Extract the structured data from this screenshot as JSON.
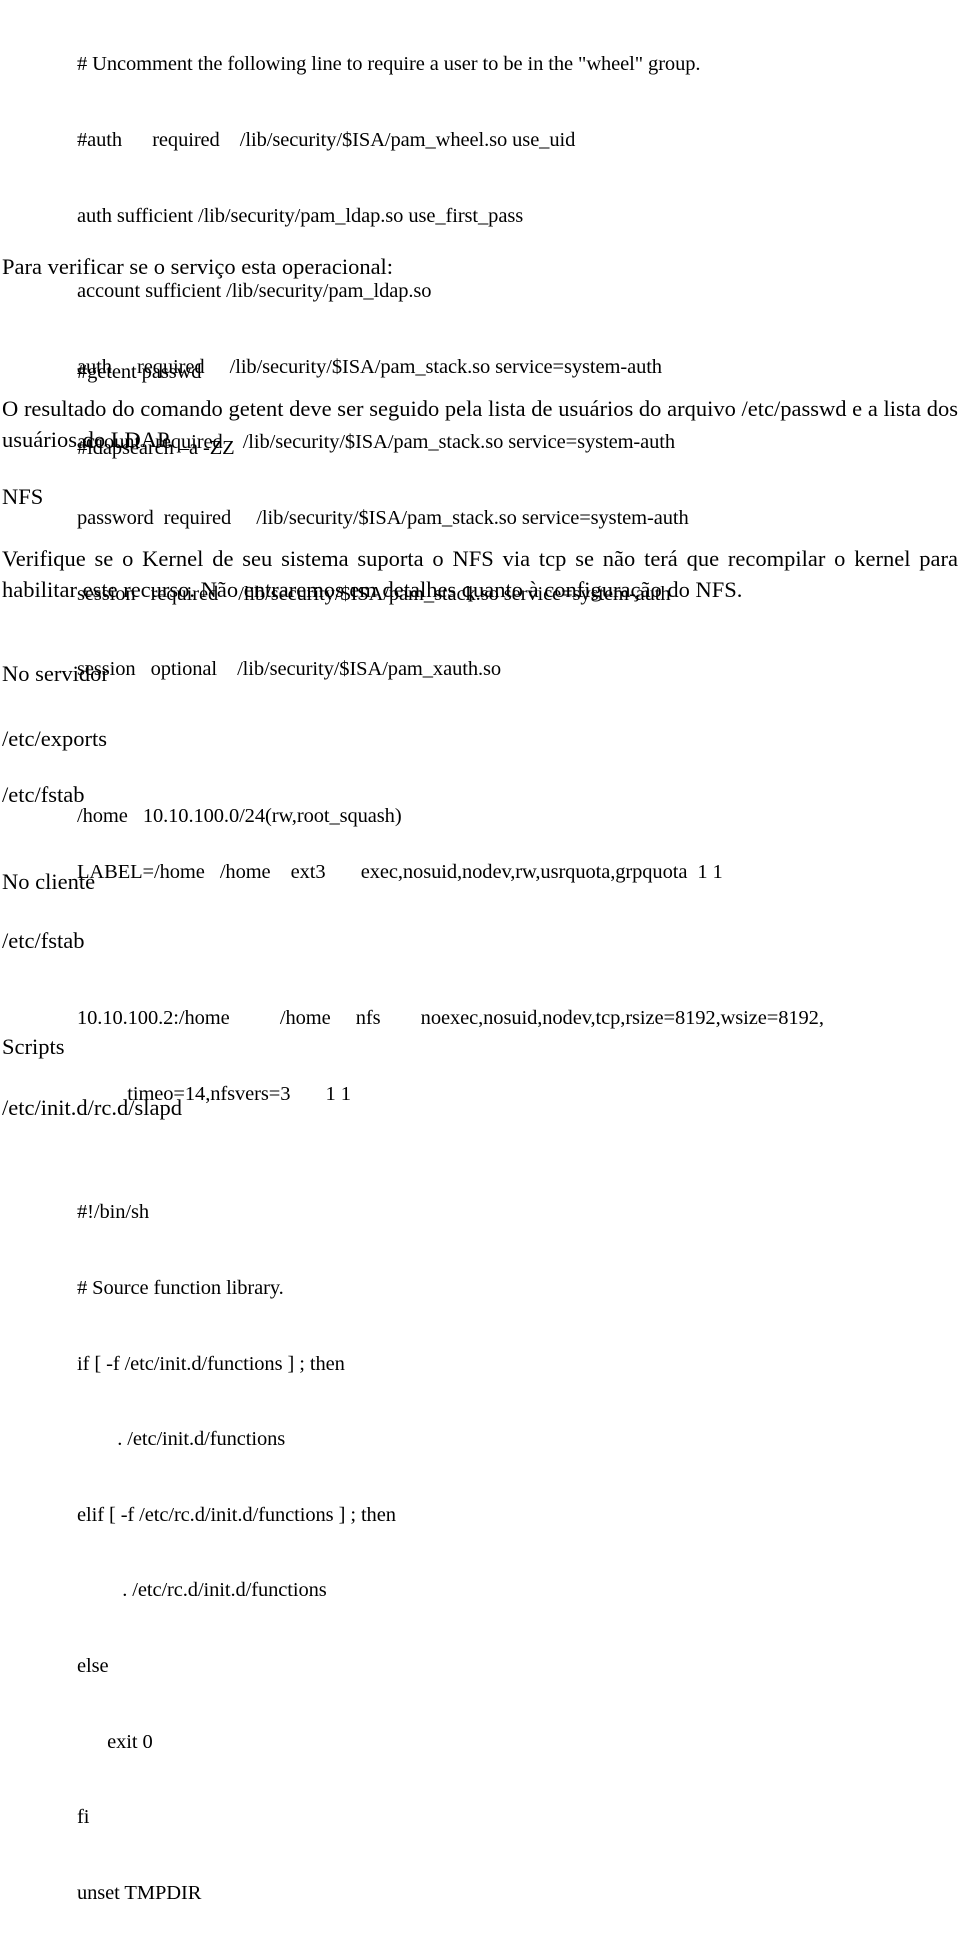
{
  "document": {
    "pam_config_block": {
      "name": "pam-ldap-configuration-lines",
      "lines": [
        "# Uncomment the following line to require a user to be in the \"wheel\" group.",
        "#auth      required    /lib/security/$ISA/pam_wheel.so use_uid",
        "auth sufficient /lib/security/pam_ldap.so use_first_pass",
        "account sufficient /lib/security/pam_ldap.so",
        "auth     required     /lib/security/$ISA/pam_stack.so service=system-auth",
        "account   required    /lib/security/$ISA/pam_stack.so service=system-auth",
        "password  required     /lib/security/$ISA/pam_stack.so service=system-auth",
        "session   required    /lib/security/$ISA/pam_stack.so service=system-auth",
        "session   optional    /lib/security/$ISA/pam_xauth.so"
      ]
    },
    "verify_intro": "Para verificar se o serviço esta operacional:",
    "verify_commands": [
      "#getent passwd",
      "#ldapsearch –a -ZZ"
    ],
    "getent_paragraph": "O resultado do comando getent deve ser seguido pela lista de usuários do arquivo /etc/passwd e a lista dos usuários do LDAP.",
    "nfs_heading": "NFS",
    "nfs_paragraph": "Verifique se o Kernel de seu sistema suporta o NFS via tcp se não terá que recompilar o kernel para habilitar este recurso. Não entraremos em detalhes quanto à configuração do NFS.",
    "server_heading": "No servidor",
    "server_exports_path": "/etc/exports",
    "server_exports_line": "/home   10.10.100.0/24(rw,root_squash)",
    "server_fstab_path": "/etc/fstab",
    "server_fstab_line": "LABEL=/home   /home    ext3       exec,nosuid,nodev,rw,usrquota,grpquota  1 1",
    "client_heading": "No cliente",
    "client_fstab_path": "/etc/fstab",
    "client_fstab_lines": [
      "10.10.100.2:/home          /home     nfs        noexec,nosuid,nodev,tcp,rsize=8192,wsize=8192,",
      "          timeo=14,nfsvers=3       1 1"
    ],
    "scripts_heading": "Scripts",
    "script_path": "/etc/init.d/rc.d/slapd",
    "script_lines": [
      "#!/bin/sh",
      "# Source function library.",
      "if [ -f /etc/init.d/functions ] ; then",
      "        . /etc/init.d/functions",
      "elif [ -f /etc/rc.d/init.d/functions ] ; then",
      "         . /etc/rc.d/init.d/functions",
      "else",
      "      exit 0",
      "fi",
      "unset TMPDIR"
    ]
  }
}
